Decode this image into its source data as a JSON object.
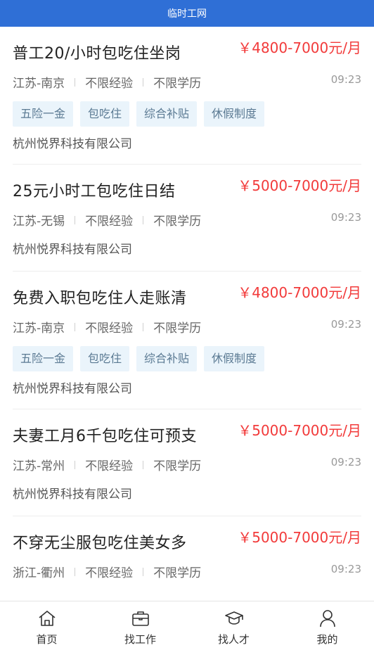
{
  "header": {
    "title": "临时工网"
  },
  "jobs": [
    {
      "title": "普工20/小时包吃住坐岗",
      "salary": "￥4800-7000元/月",
      "location": "江苏-南京",
      "experience": "不限经验",
      "education": "不限学历",
      "time": "09:23",
      "tags": [
        "五险一金",
        "包吃住",
        "综合补贴",
        "休假制度"
      ],
      "company": "杭州悦界科技有限公司"
    },
    {
      "title": "25元小时工包吃住日结",
      "salary": "￥5000-7000元/月",
      "location": "江苏-无锡",
      "experience": "不限经验",
      "education": "不限学历",
      "time": "09:23",
      "tags": [],
      "company": "杭州悦界科技有限公司"
    },
    {
      "title": "免费入职包吃住人走账清",
      "salary": "￥4800-7000元/月",
      "location": "江苏-南京",
      "experience": "不限经验",
      "education": "不限学历",
      "time": "09:23",
      "tags": [
        "五险一金",
        "包吃住",
        "综合补贴",
        "休假制度"
      ],
      "company": "杭州悦界科技有限公司"
    },
    {
      "title": "夫妻工月6千包吃住可预支",
      "salary": "￥5000-7000元/月",
      "location": "江苏-常州",
      "experience": "不限经验",
      "education": "不限学历",
      "time": "09:23",
      "tags": [],
      "company": "杭州悦界科技有限公司"
    },
    {
      "title": "不穿无尘服包吃住美女多",
      "salary": "￥5000-7000元/月",
      "location": "浙江-衢州",
      "experience": "不限经验",
      "education": "不限学历",
      "time": "09:23",
      "tags": [],
      "company": ""
    }
  ],
  "tabbar": {
    "items": [
      {
        "label": "首页",
        "icon": "home-icon"
      },
      {
        "label": "找工作",
        "icon": "briefcase-icon"
      },
      {
        "label": "找人才",
        "icon": "graduation-cap-icon"
      },
      {
        "label": "我的",
        "icon": "user-icon"
      }
    ]
  },
  "colors": {
    "header": "#2f6fd6",
    "salary": "#f23a3a",
    "tag_bg": "#eaf4fb"
  }
}
